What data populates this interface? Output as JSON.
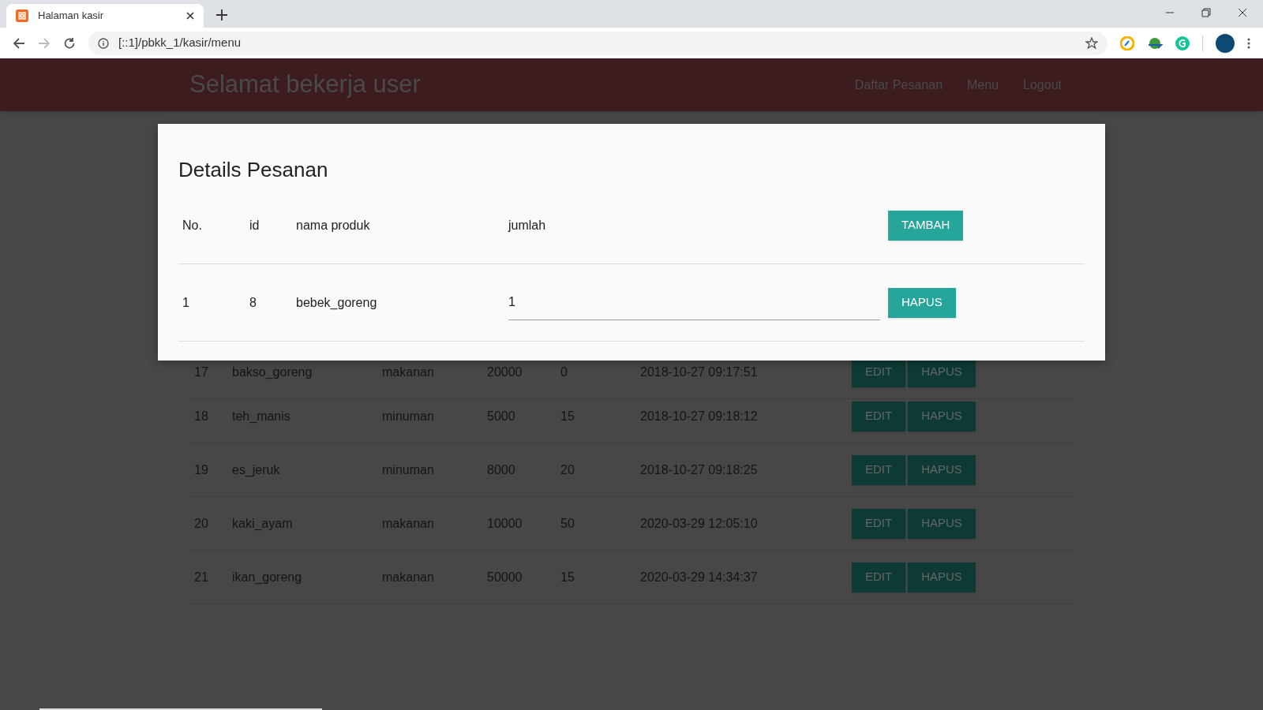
{
  "browser": {
    "tab_title": "Halaman kasir",
    "url": "[::1]/pbkk_1/kasir/menu"
  },
  "header": {
    "title": "Selamat bekerja user",
    "nav": [
      "Daftar Pesanan",
      "Menu",
      "Logout"
    ]
  },
  "menu_table": {
    "rows": [
      {
        "no": "17",
        "name": "bakso_goreng",
        "category": "makanan",
        "price": "20000",
        "stock": "0",
        "time": "2018-10-27 09:17:51",
        "edit": "EDIT",
        "delete": "HAPUS"
      },
      {
        "no": "18",
        "name": "teh_manis",
        "category": "minuman",
        "price": "5000",
        "stock": "15",
        "time": "2018-10-27 09:18:12",
        "edit": "EDIT",
        "delete": "HAPUS"
      },
      {
        "no": "19",
        "name": "es_jeruk",
        "category": "minuman",
        "price": "8000",
        "stock": "20",
        "time": "2018-10-27 09:18:25",
        "edit": "EDIT",
        "delete": "HAPUS"
      },
      {
        "no": "20",
        "name": "kaki_ayam",
        "category": "makanan",
        "price": "10000",
        "stock": "50",
        "time": "2020-03-29 12:05:10",
        "edit": "EDIT",
        "delete": "HAPUS"
      },
      {
        "no": "21",
        "name": "ikan_goreng",
        "category": "makanan",
        "price": "50000",
        "stock": "15",
        "time": "2020-03-29 14:34:37",
        "edit": "EDIT",
        "delete": "HAPUS"
      }
    ]
  },
  "modal": {
    "title": "Details Pesanan",
    "columns": [
      "No.",
      "id",
      "nama produk",
      "jumlah"
    ],
    "add_button": "TAMBAH",
    "rows": [
      {
        "no": "1",
        "id": "8",
        "product": "bebek_goreng",
        "quantity": "1",
        "delete": "HAPUS"
      }
    ]
  }
}
